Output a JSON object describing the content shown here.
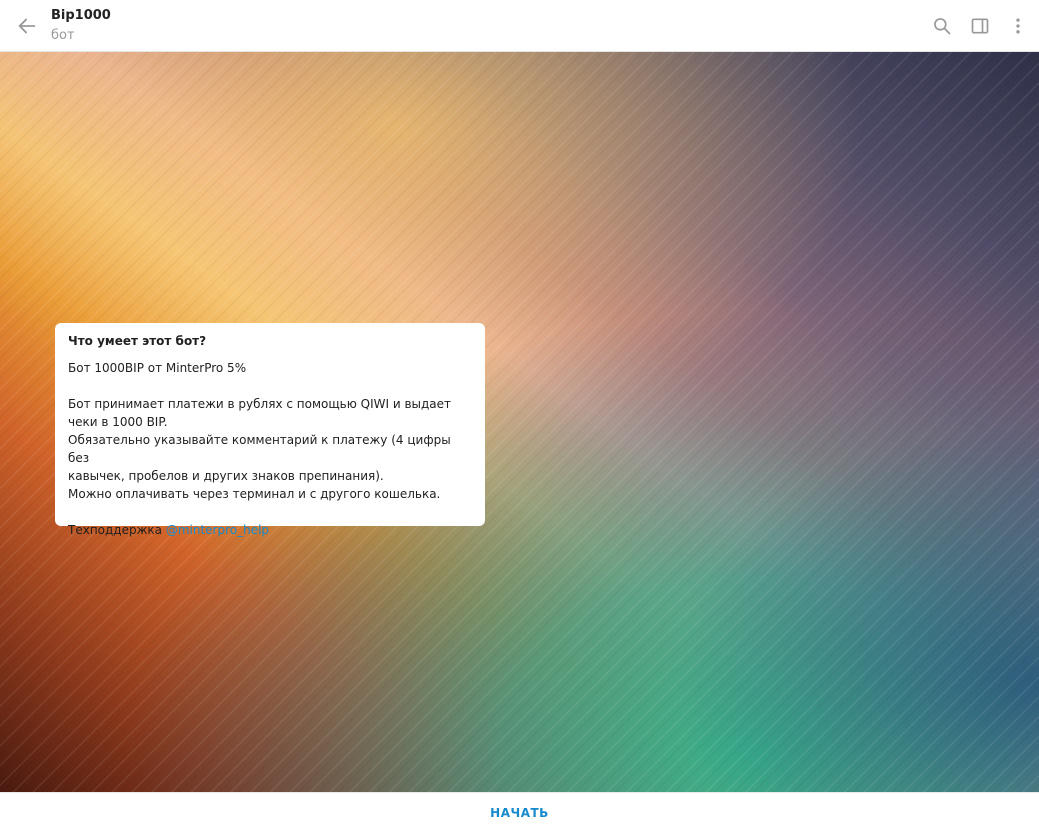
{
  "header": {
    "title": "Bip1000",
    "subtitle": "бот"
  },
  "icons": {
    "back": "arrow-left-icon",
    "search": "search-icon",
    "sidebar": "sidebar-panel-icon",
    "menu": "more-vertical-icon"
  },
  "colors": {
    "accent": "#168acd",
    "icon_gray": "#999999"
  },
  "bot_info": {
    "title": "Что умеет этот бот?",
    "line1": "Бот 1000BIP от MinterPro 5%",
    "para2_line1": "Бот принимает платежи в рублях с помощью QIWI и выдает",
    "para2_line2": "чеки в 1000 BIP.",
    "para2_line3": "Обязательно указывайте комментарий к платежу (4 цифры без",
    "para2_line4": "кавычек, пробелов и других знаков препинания).",
    "para2_line5": "Можно оплачивать через терминал и с другого кошелька.",
    "support_label": "Техподдержка ",
    "support_mention": "@minterpro_help"
  },
  "footer": {
    "start_label": "НАЧАТЬ"
  }
}
